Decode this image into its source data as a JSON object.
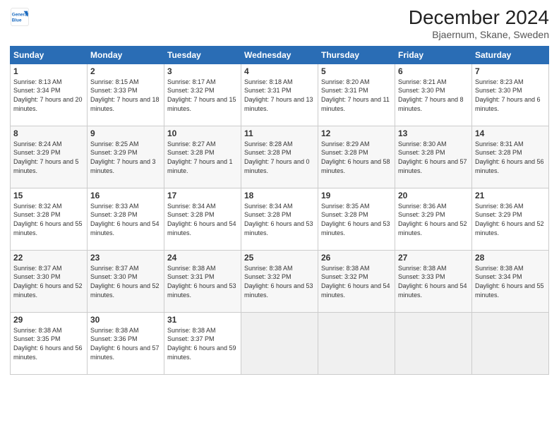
{
  "header": {
    "logo_line1": "General",
    "logo_line2": "Blue",
    "title": "December 2024",
    "subtitle": "Bjaernum, Skane, Sweden"
  },
  "days_of_week": [
    "Sunday",
    "Monday",
    "Tuesday",
    "Wednesday",
    "Thursday",
    "Friday",
    "Saturday"
  ],
  "weeks": [
    [
      {
        "day": 1,
        "sunrise": "8:13 AM",
        "sunset": "3:34 PM",
        "daylight": "7 hours and 20 minutes."
      },
      {
        "day": 2,
        "sunrise": "8:15 AM",
        "sunset": "3:33 PM",
        "daylight": "7 hours and 18 minutes."
      },
      {
        "day": 3,
        "sunrise": "8:17 AM",
        "sunset": "3:32 PM",
        "daylight": "7 hours and 15 minutes."
      },
      {
        "day": 4,
        "sunrise": "8:18 AM",
        "sunset": "3:31 PM",
        "daylight": "7 hours and 13 minutes."
      },
      {
        "day": 5,
        "sunrise": "8:20 AM",
        "sunset": "3:31 PM",
        "daylight": "7 hours and 11 minutes."
      },
      {
        "day": 6,
        "sunrise": "8:21 AM",
        "sunset": "3:30 PM",
        "daylight": "7 hours and 8 minutes."
      },
      {
        "day": 7,
        "sunrise": "8:23 AM",
        "sunset": "3:30 PM",
        "daylight": "7 hours and 6 minutes."
      }
    ],
    [
      {
        "day": 8,
        "sunrise": "8:24 AM",
        "sunset": "3:29 PM",
        "daylight": "7 hours and 5 minutes."
      },
      {
        "day": 9,
        "sunrise": "8:25 AM",
        "sunset": "3:29 PM",
        "daylight": "7 hours and 3 minutes."
      },
      {
        "day": 10,
        "sunrise": "8:27 AM",
        "sunset": "3:28 PM",
        "daylight": "7 hours and 1 minute."
      },
      {
        "day": 11,
        "sunrise": "8:28 AM",
        "sunset": "3:28 PM",
        "daylight": "7 hours and 0 minutes."
      },
      {
        "day": 12,
        "sunrise": "8:29 AM",
        "sunset": "3:28 PM",
        "daylight": "6 hours and 58 minutes."
      },
      {
        "day": 13,
        "sunrise": "8:30 AM",
        "sunset": "3:28 PM",
        "daylight": "6 hours and 57 minutes."
      },
      {
        "day": 14,
        "sunrise": "8:31 AM",
        "sunset": "3:28 PM",
        "daylight": "6 hours and 56 minutes."
      }
    ],
    [
      {
        "day": 15,
        "sunrise": "8:32 AM",
        "sunset": "3:28 PM",
        "daylight": "6 hours and 55 minutes."
      },
      {
        "day": 16,
        "sunrise": "8:33 AM",
        "sunset": "3:28 PM",
        "daylight": "6 hours and 54 minutes."
      },
      {
        "day": 17,
        "sunrise": "8:34 AM",
        "sunset": "3:28 PM",
        "daylight": "6 hours and 54 minutes."
      },
      {
        "day": 18,
        "sunrise": "8:34 AM",
        "sunset": "3:28 PM",
        "daylight": "6 hours and 53 minutes."
      },
      {
        "day": 19,
        "sunrise": "8:35 AM",
        "sunset": "3:28 PM",
        "daylight": "6 hours and 53 minutes."
      },
      {
        "day": 20,
        "sunrise": "8:36 AM",
        "sunset": "3:29 PM",
        "daylight": "6 hours and 52 minutes."
      },
      {
        "day": 21,
        "sunrise": "8:36 AM",
        "sunset": "3:29 PM",
        "daylight": "6 hours and 52 minutes."
      }
    ],
    [
      {
        "day": 22,
        "sunrise": "8:37 AM",
        "sunset": "3:30 PM",
        "daylight": "6 hours and 52 minutes."
      },
      {
        "day": 23,
        "sunrise": "8:37 AM",
        "sunset": "3:30 PM",
        "daylight": "6 hours and 52 minutes."
      },
      {
        "day": 24,
        "sunrise": "8:38 AM",
        "sunset": "3:31 PM",
        "daylight": "6 hours and 53 minutes."
      },
      {
        "day": 25,
        "sunrise": "8:38 AM",
        "sunset": "3:32 PM",
        "daylight": "6 hours and 53 minutes."
      },
      {
        "day": 26,
        "sunrise": "8:38 AM",
        "sunset": "3:32 PM",
        "daylight": "6 hours and 54 minutes."
      },
      {
        "day": 27,
        "sunrise": "8:38 AM",
        "sunset": "3:33 PM",
        "daylight": "6 hours and 54 minutes."
      },
      {
        "day": 28,
        "sunrise": "8:38 AM",
        "sunset": "3:34 PM",
        "daylight": "6 hours and 55 minutes."
      }
    ],
    [
      {
        "day": 29,
        "sunrise": "8:38 AM",
        "sunset": "3:35 PM",
        "daylight": "6 hours and 56 minutes."
      },
      {
        "day": 30,
        "sunrise": "8:38 AM",
        "sunset": "3:36 PM",
        "daylight": "6 hours and 57 minutes."
      },
      {
        "day": 31,
        "sunrise": "8:38 AM",
        "sunset": "3:37 PM",
        "daylight": "6 hours and 59 minutes."
      },
      null,
      null,
      null,
      null
    ]
  ]
}
